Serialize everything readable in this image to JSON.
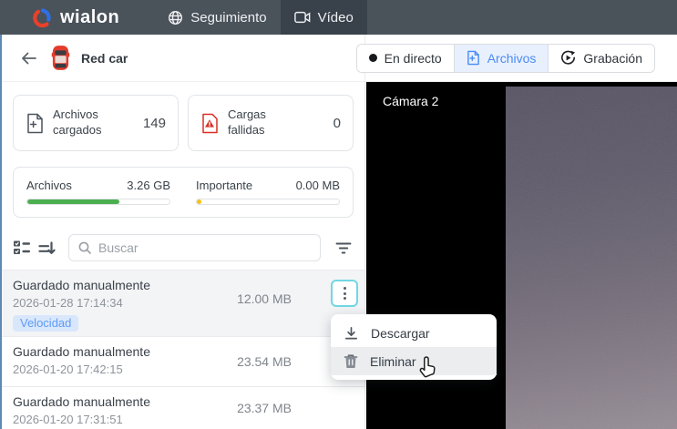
{
  "topbar": {
    "brand": "wialon",
    "tabs": [
      {
        "label": "Seguimiento",
        "icon": "globe-icon",
        "active": false
      },
      {
        "label": "Vídeo",
        "icon": "video-camera-icon",
        "active": true
      }
    ]
  },
  "header": {
    "unit_name": "Red car"
  },
  "view_switch": {
    "buttons": [
      {
        "label": "En directo",
        "icon": "live-dot-icon",
        "active": false
      },
      {
        "label": "Archivos",
        "icon": "file-import-icon",
        "active": true
      },
      {
        "label": "Grabación",
        "icon": "playback-icon",
        "active": false
      }
    ]
  },
  "stats": {
    "cards": [
      {
        "label": "Archivos cargados",
        "value": "149",
        "icon": "file-add-icon"
      },
      {
        "label": "Cargas fallidas",
        "value": "0",
        "icon": "file-error-icon"
      }
    ]
  },
  "usage": {
    "items": [
      {
        "label": "Archivos",
        "value": "3.26 GB",
        "percent": 65,
        "color": "#4caf50"
      },
      {
        "label": "Importante",
        "value": "0.00 MB",
        "percent": 3,
        "color": "#f9c116"
      }
    ]
  },
  "toolbar": {
    "search_placeholder": "Buscar"
  },
  "files": {
    "items": [
      {
        "title": "Guardado manualmente",
        "datetime": "2026-01-28 17:14:34",
        "size": "12.00 MB",
        "tag": "Velocidad",
        "selected": true
      },
      {
        "title": "Guardado manualmente",
        "datetime": "2026-01-20 17:42:15",
        "size": "23.54 MB"
      },
      {
        "title": "Guardado manualmente",
        "datetime": "2026-01-20 17:31:51",
        "size": "23.37 MB"
      }
    ]
  },
  "context_menu": {
    "items": [
      {
        "label": "Descargar",
        "icon": "download-icon"
      },
      {
        "label": "Eliminar",
        "icon": "trash-icon",
        "hovered": true
      }
    ]
  },
  "video": {
    "camera_label": "Cámara 2"
  },
  "colors": {
    "topbar_bg": "#4a525a",
    "topbar_active_bg": "#39414a",
    "accent_blue": "#4b8bf5",
    "segment_active_bg": "#e8f0fe",
    "selection_cyan": "#70d8e2",
    "progress_green": "#4caf50",
    "progress_yellow": "#f9c116",
    "tag_bg": "#d9e7fc",
    "tag_text": "#5e9bf7",
    "error_red": "#d93025"
  }
}
